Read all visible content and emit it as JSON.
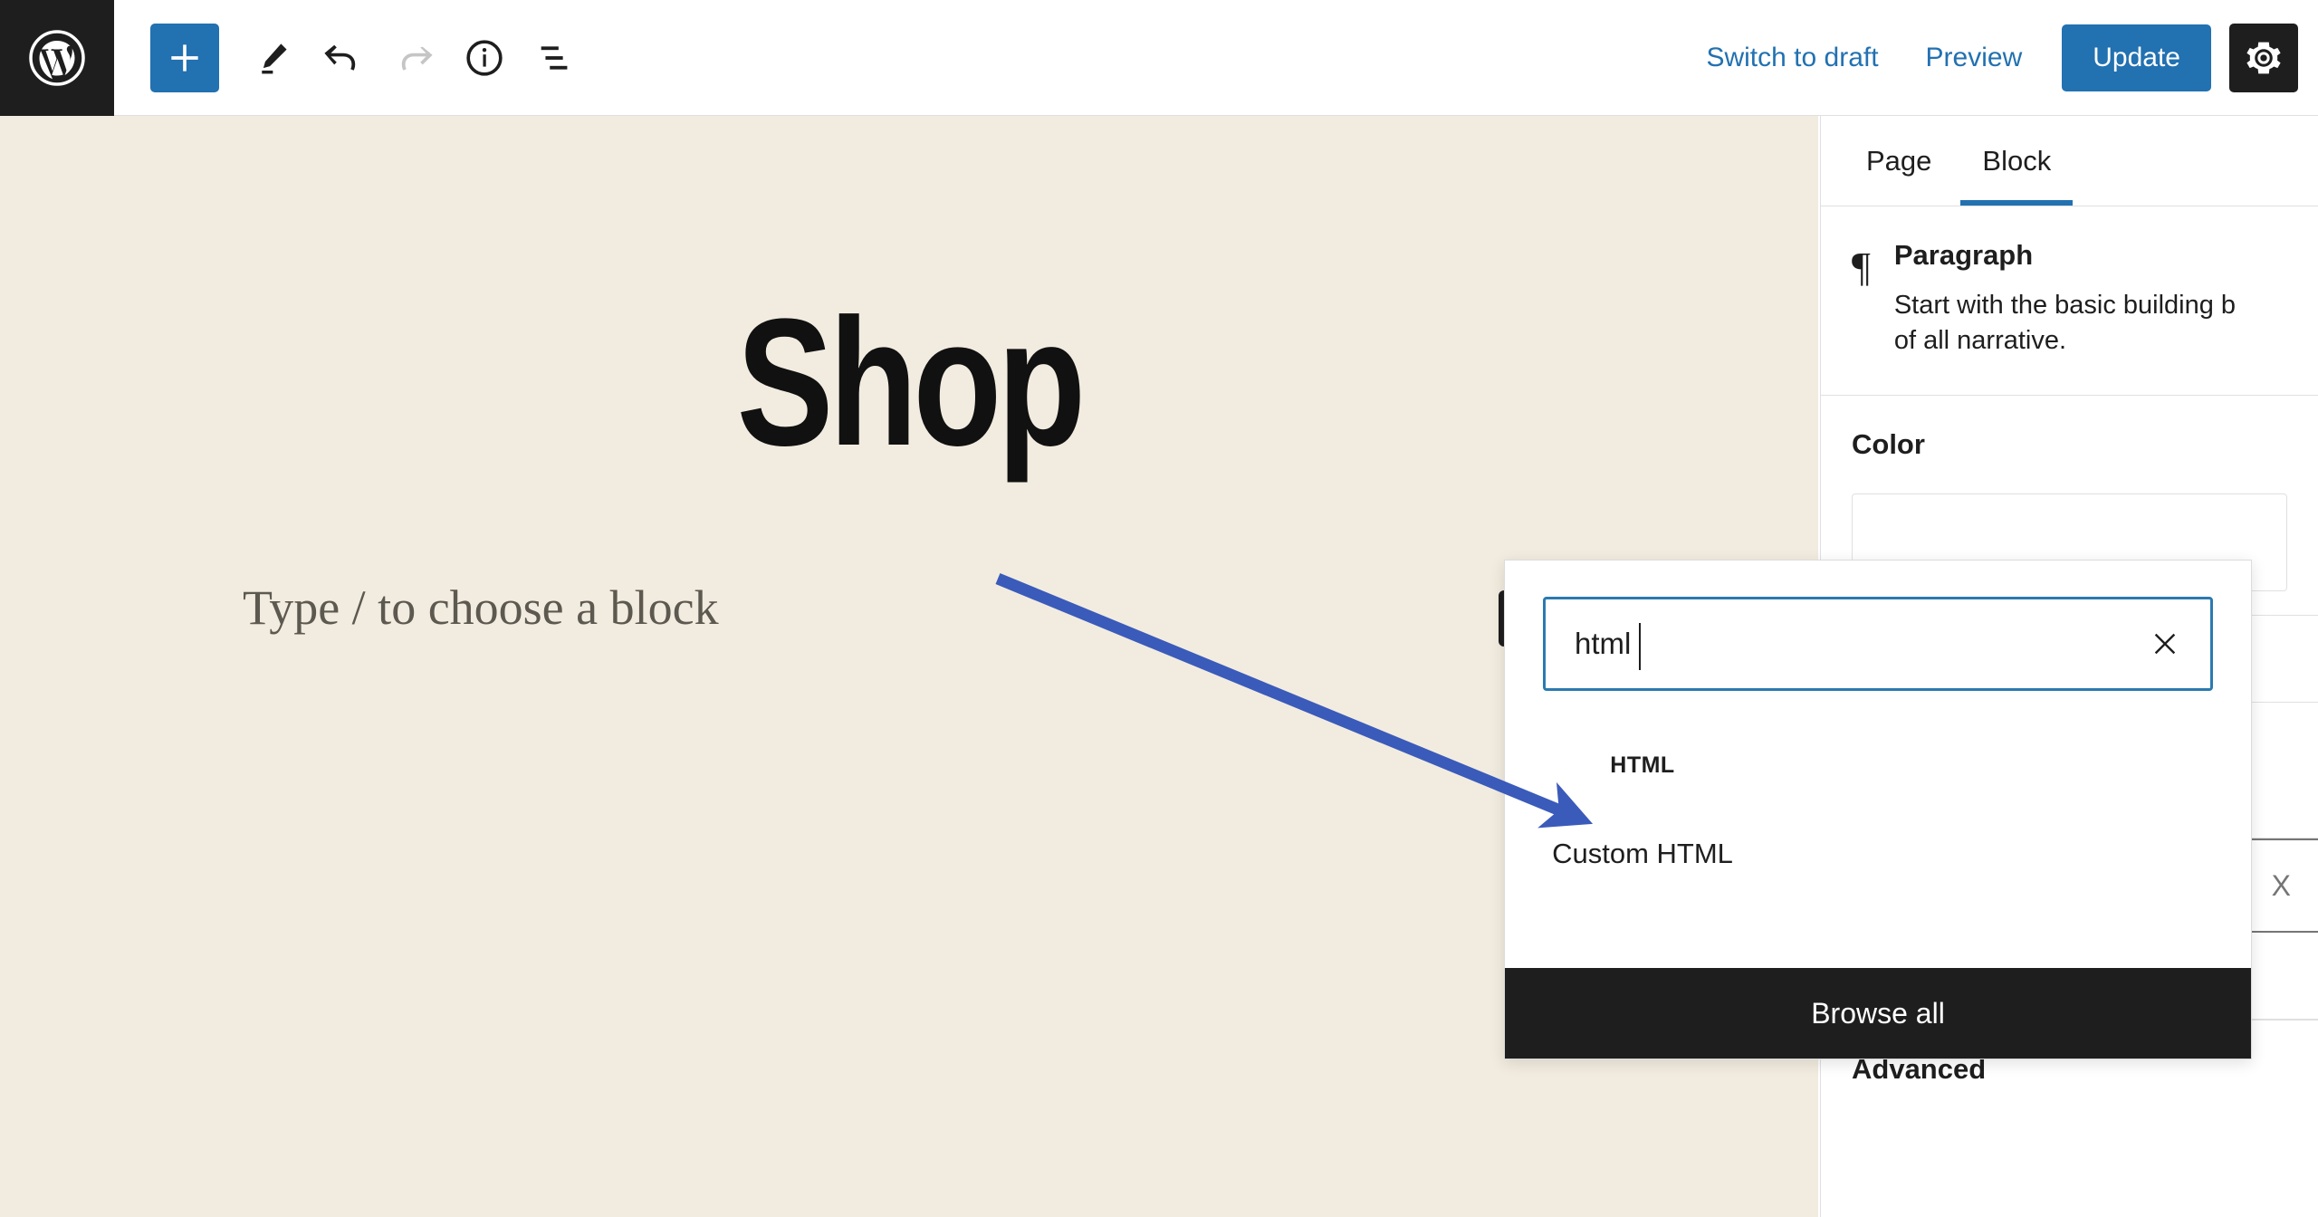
{
  "toolbar": {
    "logo_icon": "wordpress-logo-icon",
    "add_block_icon": "plus-icon",
    "tools_icon": "pencil-icon",
    "undo_icon": "undo-arrow-icon",
    "redo_icon": "redo-arrow-icon",
    "details_icon": "info-circle-icon",
    "list_view_icon": "list-view-icon",
    "switch_to_draft_label": "Switch to draft",
    "preview_label": "Preview",
    "update_label": "Update",
    "settings_icon": "gear-icon",
    "accent_color": "#2271b1",
    "dark_color": "#1e1e1e"
  },
  "canvas": {
    "background_color": "#f2ece0",
    "post_title": "Shop",
    "paragraph_placeholder": "Type / to choose a block",
    "inserter_icon": "plus-icon"
  },
  "sidebar": {
    "tabs": [
      {
        "label": "Page",
        "active": false
      },
      {
        "label": "Block",
        "active": true
      }
    ],
    "block_card": {
      "icon": "pilcrow-icon",
      "name": "Paragraph",
      "description": "Start with the basic building b\nof all narrative."
    },
    "color_heading": "Color",
    "size_label": "X",
    "advanced_heading": "Advanced"
  },
  "inserter": {
    "search_value": "html",
    "clear_icon": "close-x-icon",
    "results": [
      {
        "icon_text": "HTML",
        "label": "Custom HTML"
      }
    ],
    "browse_all_label": "Browse all"
  },
  "annotation": {
    "arrow_color": "#3b5bba"
  }
}
